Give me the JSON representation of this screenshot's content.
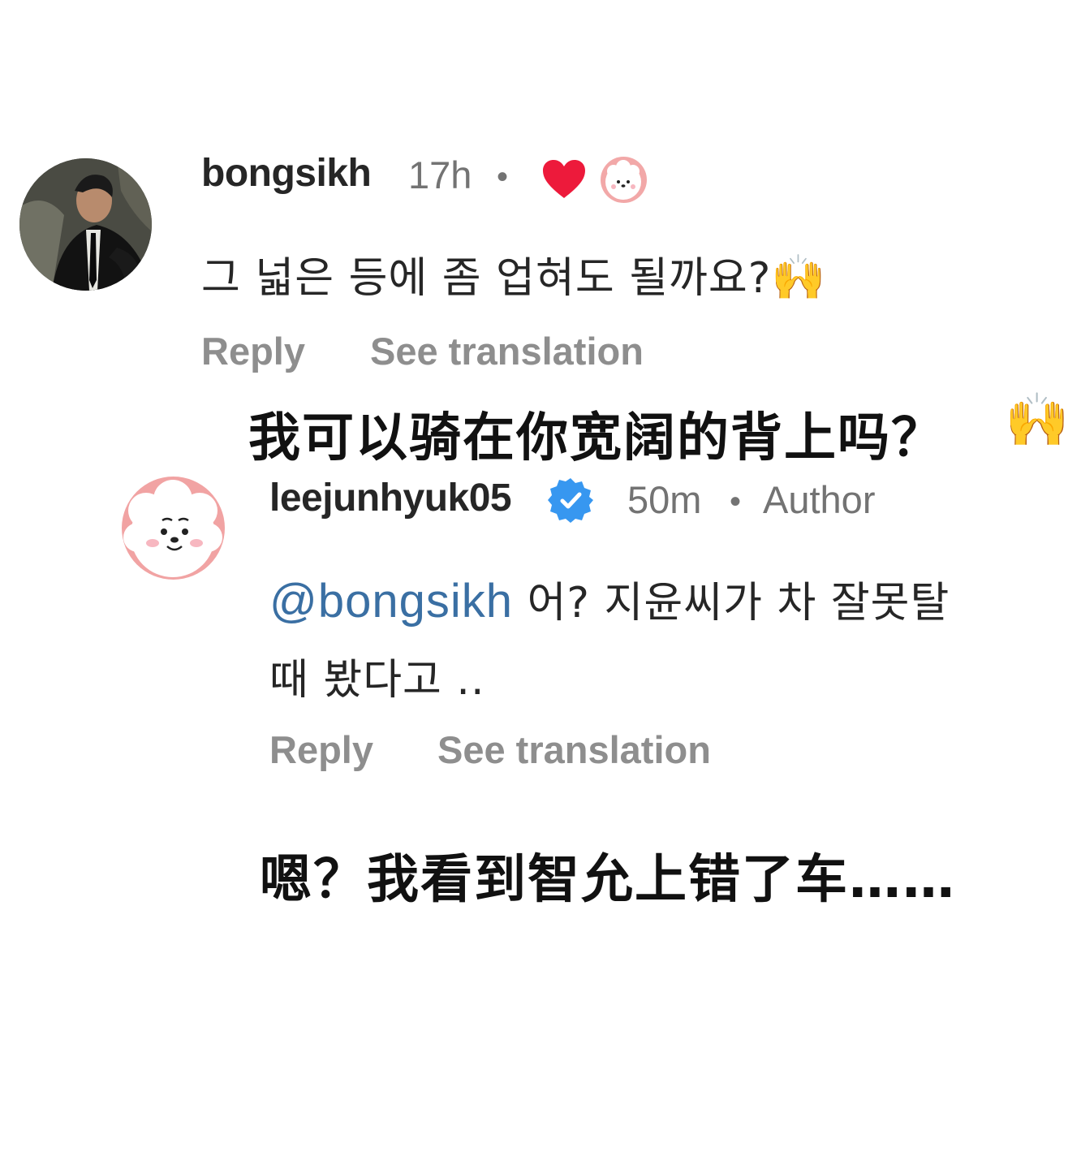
{
  "comments": [
    {
      "username": "bongsikh",
      "time": "17h",
      "separator": "•",
      "text": "그 넓은 등에 좀 업혀도 될까요?",
      "emoji": "🙌",
      "reply_label": "Reply",
      "translate_label": "See translation",
      "liked_icon": "heart-icon",
      "liked_by_avatar": "dog-avatar-icon"
    },
    {
      "username": "leejunhyuk05",
      "verified": true,
      "time": "50m",
      "separator": "•",
      "author_label": "Author",
      "mention": "@bongsikh",
      "text_line1": " 어? 지윤씨가 차 잘못탈",
      "text_line2": "때 봤다고 ..",
      "reply_label": "Reply",
      "translate_label": "See translation"
    }
  ],
  "overlays": {
    "translation1": "我可以骑在你宽阔的背上吗？",
    "translation1_emoji": "🙌",
    "translation2": "嗯？我看到智允上错了车……"
  },
  "colors": {
    "heart": "#ed1a3b",
    "verified": "#3797f0",
    "mention": "#3a6fa3",
    "muted": "#737373",
    "action": "#8e8e8e"
  }
}
